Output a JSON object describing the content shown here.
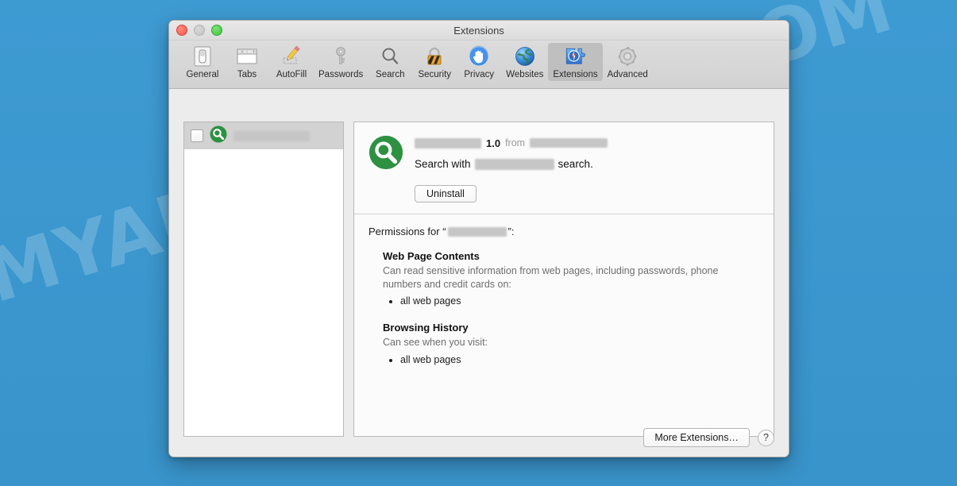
{
  "watermark": {
    "text": "MYANTISPYWARE.COM"
  },
  "window": {
    "title": "Extensions",
    "traffic_lights": [
      {
        "name": "close",
        "color": "#f2564b"
      },
      {
        "name": "minimize",
        "color": "#c4c4c4"
      },
      {
        "name": "zoom",
        "color": "#3dc63a"
      }
    ]
  },
  "toolbar": {
    "items": [
      {
        "label": "General",
        "icon": "general-switch-icon",
        "selected": false
      },
      {
        "label": "Tabs",
        "icon": "tabs-icon",
        "selected": false
      },
      {
        "label": "AutoFill",
        "icon": "pencil-icon",
        "selected": false
      },
      {
        "label": "Passwords",
        "icon": "key-icon",
        "selected": false
      },
      {
        "label": "Search",
        "icon": "magnifier-icon",
        "selected": false
      },
      {
        "label": "Security",
        "icon": "padlock-icon",
        "selected": false
      },
      {
        "label": "Privacy",
        "icon": "hand-icon",
        "selected": false
      },
      {
        "label": "Websites",
        "icon": "globe-icon",
        "selected": false
      },
      {
        "label": "Extensions",
        "icon": "puzzle-compass-icon",
        "selected": true
      },
      {
        "label": "Advanced",
        "icon": "gear-icon",
        "selected": false
      }
    ]
  },
  "extension_list": {
    "rows": [
      {
        "name_redacted": true,
        "icon": "green-magnifier-icon",
        "checked": false,
        "selected": true,
        "redacted_width": 96
      }
    ]
  },
  "detail": {
    "icon": "green-magnifier-icon",
    "name_redacted_width": 84,
    "version": "1.0",
    "from_label": "from",
    "publisher_redacted_width": 98,
    "description_prefix": "Search with",
    "description_redacted_width": 100,
    "description_suffix": "search.",
    "uninstall_label": "Uninstall"
  },
  "permissions": {
    "title_prefix": "Permissions for “",
    "title_redacted_width": 74,
    "title_suffix": "”:",
    "groups": [
      {
        "heading": "Web Page Contents",
        "description": "Can read sensitive information from web pages, including passwords, phone numbers and credit cards on:",
        "items": [
          "all web pages"
        ]
      },
      {
        "heading": "Browsing History",
        "description": "Can see when you visit:",
        "items": [
          "all web pages"
        ]
      }
    ]
  },
  "footer": {
    "more_extensions_label": "More Extensions…",
    "help_label": "?"
  },
  "colors": {
    "desktop_blue": "#3d9ad1",
    "extension_green": "#2e9142",
    "selection_gray": "#d2d2d2",
    "toolbar_selected": "#bfbfbf"
  }
}
